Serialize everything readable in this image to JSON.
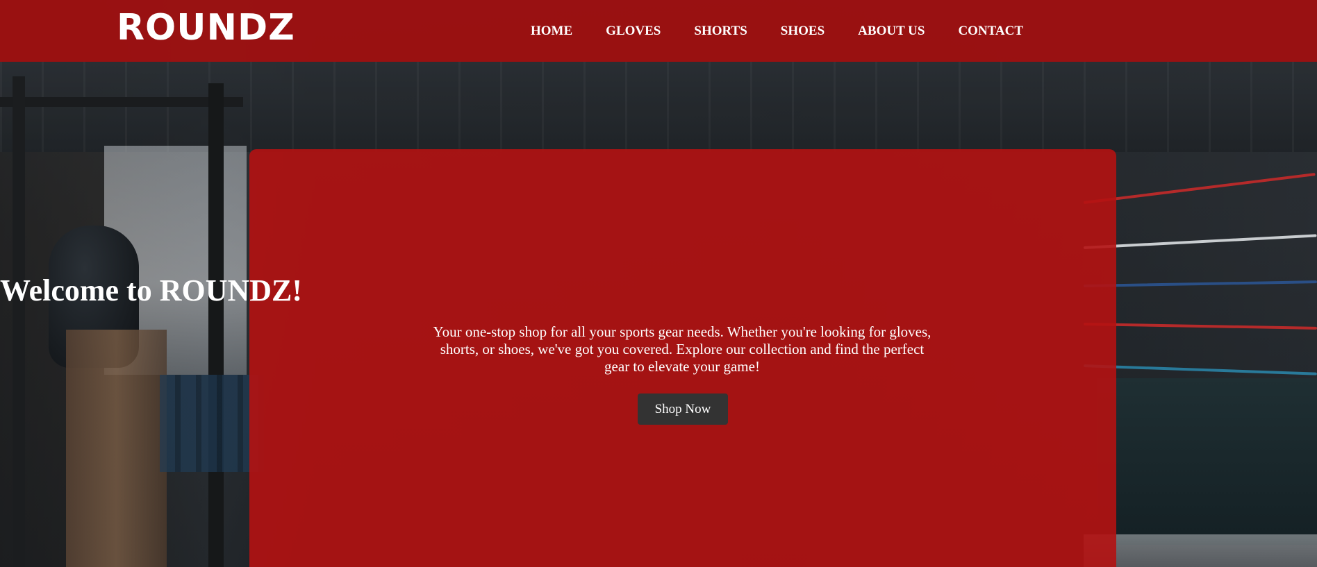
{
  "brand": {
    "logo_text": "ROUNDZ"
  },
  "nav": {
    "items": [
      {
        "label": "HOME"
      },
      {
        "label": "GLOVES"
      },
      {
        "label": "SHORTS"
      },
      {
        "label": "SHOES"
      },
      {
        "label": "ABOUT US"
      },
      {
        "label": "CONTACT"
      }
    ]
  },
  "hero": {
    "title": "Welcome to ROUNDZ!",
    "text": "Your one-stop shop for all your sports gear needs. Whether you're looking for gloves, shorts, or shoes, we've got you covered. Explore our collection and find the perfect gear to elevate your game!",
    "button_label": "Shop Now"
  },
  "colors": {
    "header_bg": "#a01010",
    "hero_bg": "#b41212",
    "button_bg": "#333333",
    "text": "#ffffff"
  }
}
